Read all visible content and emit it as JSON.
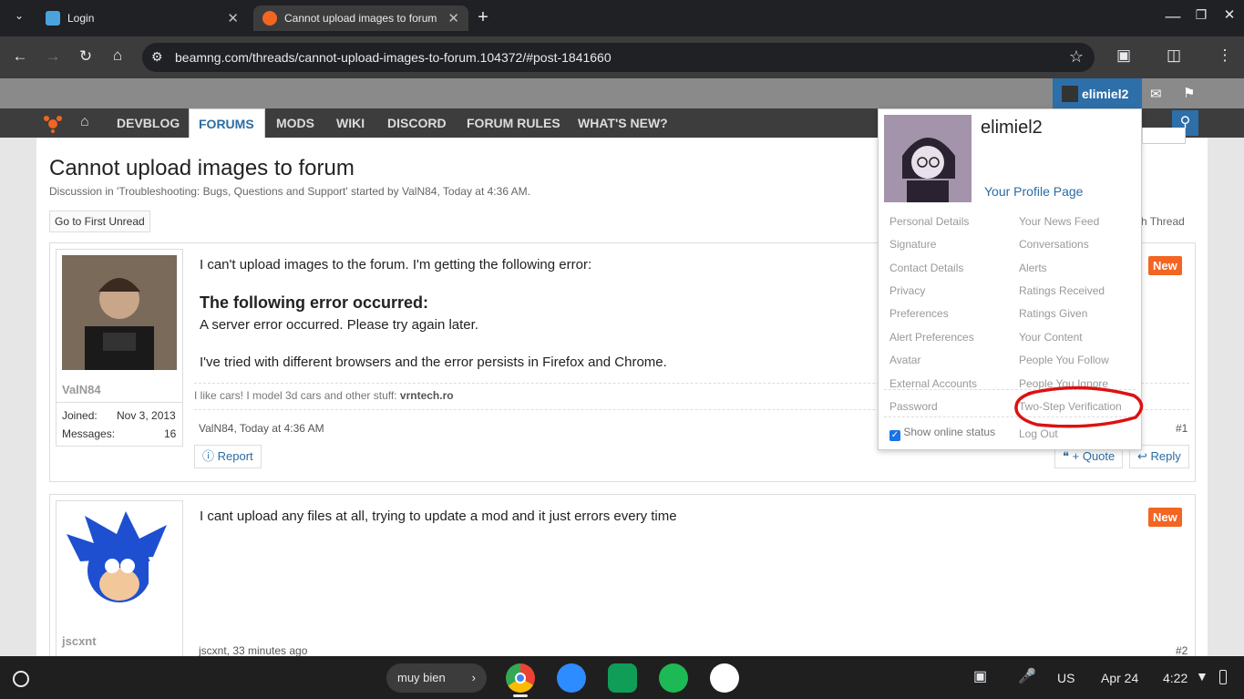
{
  "browser": {
    "tabs": [
      {
        "title": "Login",
        "active": false
      },
      {
        "title": "Cannot upload images to forum",
        "active": true
      }
    ],
    "url": "beamng.com/threads/cannot-upload-images-to-forum.104372/#post-1841660"
  },
  "header": {
    "username": "elimiel2",
    "nav": [
      "DEVBLOG",
      "FORUMS",
      "MODS",
      "WIKI",
      "DISCORD",
      "FORUM RULES",
      "WHAT'S NEW?"
    ],
    "active_nav": "FORUMS"
  },
  "thread": {
    "title": "Cannot upload images to forum",
    "meta": "Discussion in 'Troubleshooting: Bugs, Questions and Support' started by ValN84, Today at 4:36 AM.",
    "go_first_unread": "Go to First Unread",
    "watch_thread": "atch Thread"
  },
  "posts": [
    {
      "user": "ValN84",
      "joined_label": "Joined:",
      "joined": "Nov 3, 2013",
      "messages_label": "Messages:",
      "messages": "16",
      "line1": "I can't upload images to the forum. I'm getting the following error:",
      "error_heading": "The following error occurred:",
      "error_text": "A server error occurred. Please try again later.",
      "line2": "I've tried with different browsers and the error persists in Firefox and Chrome.",
      "signature": "I like cars! I model 3d cars and other stuff:",
      "signature_link": "vrntech.ro",
      "footer": "ValN84, Today at 4:36 AM",
      "number": "#1",
      "badge": "New",
      "report": "Report",
      "quote": "+ Quote",
      "reply": "Reply"
    },
    {
      "user": "jscxnt",
      "text": "I cant upload any files at all, trying to update a mod and it just errors every time",
      "footer": "jscxnt, 33 minutes ago",
      "number": "#2",
      "badge": "New"
    }
  ],
  "dropdown": {
    "username": "elimiel2",
    "profile_link": "Your Profile Page",
    "left_col": [
      "Personal Details",
      "Signature",
      "Contact Details",
      "Privacy",
      "Preferences",
      "Alert Preferences",
      "Avatar",
      "External Accounts",
      "Password"
    ],
    "right_col": [
      "Your News Feed",
      "Conversations",
      "Alerts",
      "Ratings Received",
      "Ratings Given",
      "Your Content",
      "People You Follow",
      "People You Ignore",
      "Two-Step Verification"
    ],
    "show_online": "Show online status",
    "logout": "Log Out"
  },
  "taskbar": {
    "pill_text": "muy bien",
    "lang": "US",
    "date": "Apr 24",
    "time": "4:22"
  }
}
